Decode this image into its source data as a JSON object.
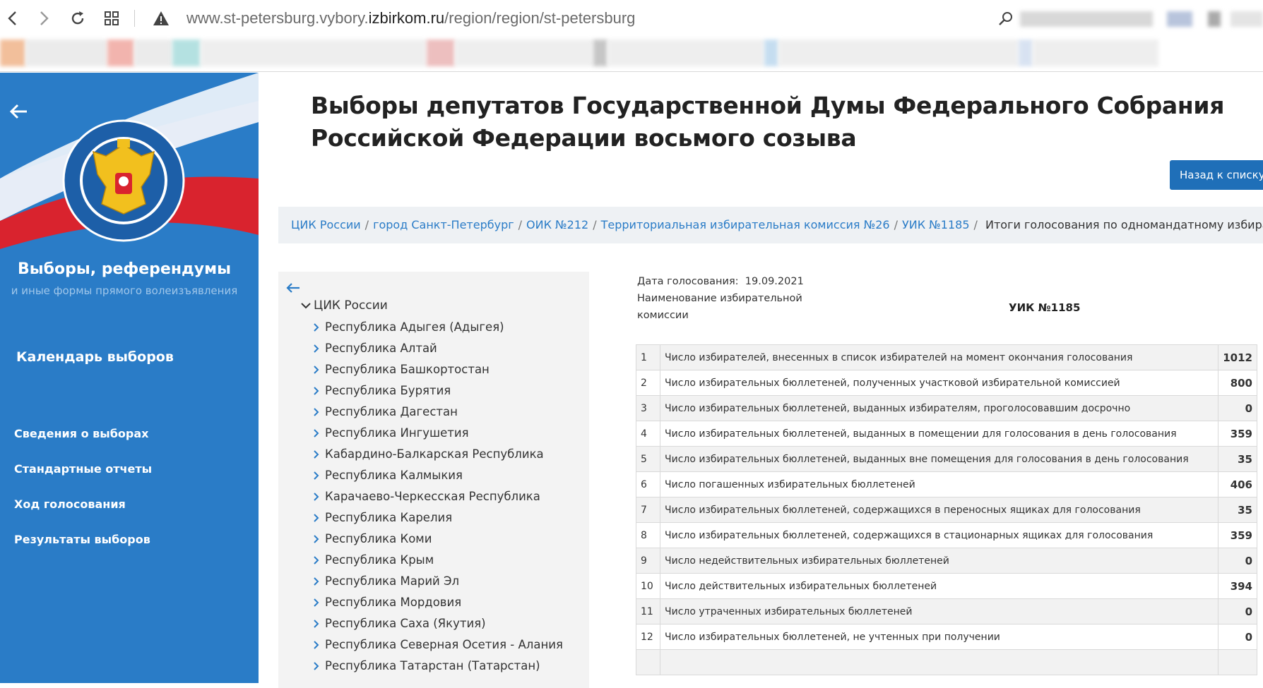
{
  "browser": {
    "url_host_prefix": "www.st-petersburg.vybory.",
    "url_host_main": "izbirkom.ru",
    "url_path": "/region/region/st-petersburg"
  },
  "sidebar": {
    "title": "Выборы, референдумы",
    "subtitle": "и иные формы прямого волеизъявления",
    "calendar": "Календарь выборов",
    "menu": [
      {
        "label": "Сведения о выборах"
      },
      {
        "label": "Стандартные отчеты"
      },
      {
        "label": "Ход голосования"
      },
      {
        "label": "Результаты выборов"
      }
    ]
  },
  "main": {
    "title": "Выборы депутатов Государственной Думы Федерального Собрания Российской Федерации восьмого созыва",
    "back_button": "Назад к списку",
    "breadcrumbs": [
      {
        "label": "ЦИК России"
      },
      {
        "label": "город Санкт-Петербург"
      },
      {
        "label": "ОИК №212"
      },
      {
        "label": "Территориальная избирательная комиссия №26"
      },
      {
        "label": "УИК №1185"
      }
    ],
    "breadcrumb_current": "Итоги голосования по одномандатному избирательному округу"
  },
  "tree": {
    "root": "ЦИК России",
    "items": [
      "Республика Адыгея (Адыгея)",
      "Республика Алтай",
      "Республика Башкортостан",
      "Республика Бурятия",
      "Республика Дагестан",
      "Республика Ингушетия",
      "Кабардино-Балкарская Республика",
      "Республика Калмыкия",
      "Карачаево-Черкесская Республика",
      "Республика Карелия",
      "Республика Коми",
      "Республика Крым",
      "Республика Марий Эл",
      "Республика Мордовия",
      "Республика Саха (Якутия)",
      "Республика Северная Осетия - Алания",
      "Республика Татарстан (Татарстан)"
    ]
  },
  "results": {
    "date_label": "Дата голосования:",
    "date_value": "19.09.2021",
    "commission_label_1": "Наименование избирательной",
    "commission_label_2": "комиссии",
    "commission_name": "УИК №1185",
    "rows": [
      {
        "n": "1",
        "label": "Число избирателей, внесенных в список избирателей на момент окончания голосования",
        "value": "1012"
      },
      {
        "n": "2",
        "label": "Число избирательных бюллетеней, полученных участковой избирательной комиссией",
        "value": "800"
      },
      {
        "n": "3",
        "label": "Число избирательных бюллетеней, выданных избирателям, проголосовавшим досрочно",
        "value": "0"
      },
      {
        "n": "4",
        "label": "Число избирательных бюллетеней, выданных в помещении для голосования в день голосования",
        "value": "359"
      },
      {
        "n": "5",
        "label": "Число избирательных бюллетеней, выданных вне помещения для голосования в день голосования",
        "value": "35"
      },
      {
        "n": "6",
        "label": "Число погашенных избирательных бюллетеней",
        "value": "406"
      },
      {
        "n": "7",
        "label": "Число избирательных бюллетеней, содержащихся в переносных ящиках для голосования",
        "value": "35"
      },
      {
        "n": "8",
        "label": "Число избирательных бюллетеней, содержащихся в стационарных ящиках для голосования",
        "value": "359"
      },
      {
        "n": "9",
        "label": "Число недействительных избирательных бюллетеней",
        "value": "0"
      },
      {
        "n": "10",
        "label": "Число действительных избирательных бюллетеней",
        "value": "394"
      },
      {
        "n": "11",
        "label": "Число утраченных избирательных бюллетеней",
        "value": "0"
      },
      {
        "n": "12",
        "label": "Число избирательных бюллетеней, не учтенных при получении",
        "value": "0"
      }
    ]
  },
  "colors": {
    "sidebar_blue": "#2a7cc7",
    "button_blue": "#1f6fb8",
    "link_blue": "#2a7cc7"
  }
}
